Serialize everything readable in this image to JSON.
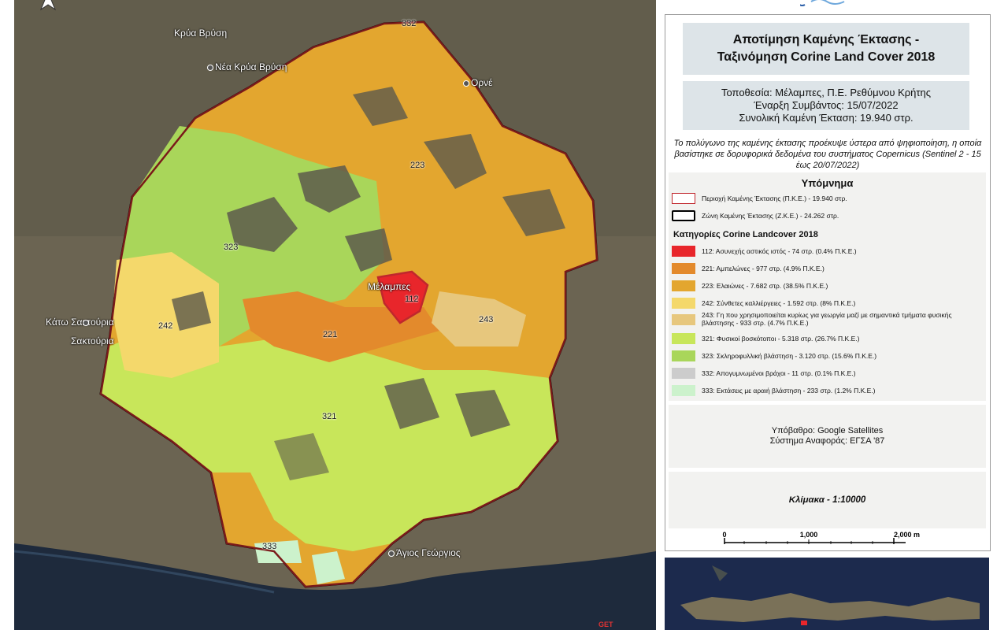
{
  "map": {
    "places": [
      {
        "name": "Κρύα Βρύση"
      },
      {
        "name": "Νέα Κρύα Βρύση"
      },
      {
        "name": "Ορνέ"
      },
      {
        "name": "Μέλαμπες"
      },
      {
        "name": "Κάτω Σακτούρια"
      },
      {
        "name": "Σακτούρια"
      },
      {
        "name": "Άγιος Γεώργιος"
      }
    ],
    "zone_labels": [
      "332",
      "223",
      "323",
      "242",
      "112",
      "221",
      "243",
      "321",
      "333"
    ],
    "credit": "GET"
  },
  "panel": {
    "title_line1": "Αποτίμηση Καμένης Έκτασης -",
    "title_line2": "Ταξινόμηση Corine Land Cover 2018",
    "info_line1": "Τοποθεσία: Μέλαμπες, Π.Ε. Ρεθύμνου Κρήτης",
    "info_line2": "Έναρξη Συμβάντος: 15/07/2022",
    "info_line3": "Συνολική Καμένη Έκταση: 19.940 στρ.",
    "note": "Το πολύγωνο της καμένης έκτασης προέκυψε ύστερα από ψηφιοποίηση, η οποία βασίστηκε σε δορυφορικά δεδομένα του συστήματος Copernicus (Sentinel 2 - 15 έως 20/07/2022)",
    "legend": {
      "title": "Υπόμνημα",
      "boundary_items": [
        {
          "label": "Περιοχή Καμένης Έκτασης (Π.Κ.Ε.) - 19.940 στρ.",
          "color": "#c0272d"
        },
        {
          "label": "Ζώνη Καμένης Έκτασης (Ζ.Κ.Ε.) - 24.262 στρ.",
          "color": "#000000"
        }
      ],
      "subtitle": "Κατηγορίες Corine Landcover 2018",
      "classes": [
        {
          "label": "112: Ασυνεχής αστικός ιστός - 74 στρ. (0.4% Π.Κ.Ε.)",
          "color": "#e8262b"
        },
        {
          "label": "221: Αμπελώνες - 977 στρ. (4.9% Π.Κ.Ε.)",
          "color": "#e38a2c"
        },
        {
          "label": "223: Ελαιώνες - 7.682 στρ. (38.5% Π.Κ.Ε.)",
          "color": "#e3a62f"
        },
        {
          "label": "242: Σύνθετες καλλιέργειες - 1.592 στρ. (8% Π.Κ.Ε.)",
          "color": "#f4d86b"
        },
        {
          "label": "243: Γη που χρησιμοποιείται κυρίως για γεωργία μαζί με σημαντικά τμήματα φυσικής βλάστησης - 933 στρ. (4.7% Π.Κ.Ε.)",
          "color": "#e7c77d"
        },
        {
          "label": "321: Φυσικοί βοσκότοποι - 5.318 στρ. (26.7% Π.Κ.Ε.)",
          "color": "#c8e65a"
        },
        {
          "label": "323: Σκληροφυλλική βλάστηση - 3.120 στρ. (15.6% Π.Κ.Ε.)",
          "color": "#a9d65a"
        },
        {
          "label": "332: Απογυμνωμένοι βράχοι - 11 στρ. (0.1% Π.Κ.Ε.)",
          "color": "#cccccc"
        },
        {
          "label": "333: Εκτάσεις με αραιή βλάστηση - 233 στρ. (1.2% Π.Κ.Ε.)",
          "color": "#ccf2cc"
        }
      ]
    },
    "basemap_line1": "Υπόβαθρο: Google Satellites",
    "basemap_line2": "Σύστημα Αναφοράς: ΕΓΣΑ '87",
    "scale": "Κλίμακα - 1:10000",
    "scalebar_ticks": [
      "0",
      "1,000",
      "2,000 m"
    ]
  }
}
